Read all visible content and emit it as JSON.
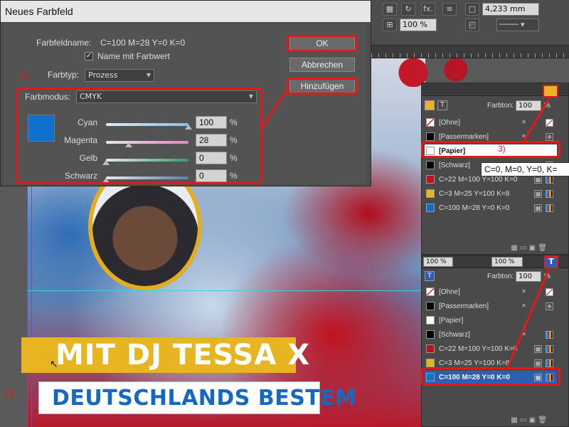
{
  "dialog": {
    "title": "Neues Farbfeld",
    "swatch_name_label": "Farbfeldname:",
    "swatch_name_value": "C=100 M=28 Y=0 K=0",
    "name_with_value_label": "Name mit Farbwert",
    "name_with_value_checked": "✓",
    "color_type_label": "Farbtyp:",
    "color_type_value": "Prozess",
    "color_mode_label": "Farbmodus:",
    "color_mode_value": "CMYK",
    "preview_color": "#1070cd",
    "channels": [
      {
        "label": "Cyan",
        "value": "100",
        "unit": "%",
        "fraction": 1.0,
        "color": "#7ac6ee"
      },
      {
        "label": "Magenta",
        "value": "28",
        "unit": "%",
        "fraction": 0.28,
        "color": "#e087c0"
      },
      {
        "label": "Gelb",
        "value": "0",
        "unit": "%",
        "fraction": 0.0,
        "color": "#2fa06a"
      },
      {
        "label": "Schwarz",
        "value": "0",
        "unit": "%",
        "fraction": 0.0,
        "color": "#5a7fa8"
      }
    ],
    "buttons": {
      "ok": "OK",
      "cancel": "Abbrechen",
      "add": "Hinzufügen"
    }
  },
  "annotations": {
    "marker_1": "1)",
    "marker_2": "2)",
    "marker_3": "3)",
    "highlight_color": "#e31818"
  },
  "toolbar": {
    "icons": [
      "frame-icon",
      "rotate-icon",
      "fx-icon",
      "stroke-icon"
    ],
    "fx_label": "fx.",
    "stroke_value": "4,233 mm",
    "zoom_value": "100 %"
  },
  "document": {
    "headline": "MIT DJ TESSA X",
    "subline": "DEUTSCHLANDS BESTEM",
    "banner_color": "#e7b422",
    "subline_color": "#1569c3"
  },
  "swatches_top": {
    "tint_label": "Farbton:",
    "tint_value": "100",
    "tint_unit": "%",
    "active_fill_color": "#e7b422",
    "rows": [
      {
        "label": "[Ohne]",
        "chip": "none"
      },
      {
        "label": "[Passermarken]",
        "chip": "#000000"
      },
      {
        "label": "[Papier]",
        "chip": "#ffffff"
      },
      {
        "label": "[Schwarz]",
        "chip": "#000000"
      },
      {
        "label": "C=22 M=100 Y=100 K=0",
        "chip": "#b8141f"
      },
      {
        "label": "C=3 M=25 Y=100 K=8",
        "chip": "#e7b422"
      },
      {
        "label": "C=100 M=28 Y=0 K=0",
        "chip": "#1070cd"
      }
    ],
    "tooltip": "C=0, M=0, Y=0, K="
  },
  "swatches_bottom": {
    "tint_label": "Farbton:",
    "tint_value": "100",
    "tint_unit": "%",
    "stroke_pct": "100 %",
    "fill_pct": "100 %",
    "rows": [
      {
        "label": "[Ohne]",
        "chip": "none"
      },
      {
        "label": "[Passermarken]",
        "chip": "#000000"
      },
      {
        "label": "[Papier]",
        "chip": "#ffffff"
      },
      {
        "label": "[Schwarz]",
        "chip": "#000000"
      },
      {
        "label": "C=22 M=100 Y=100 K=0",
        "chip": "#b8141f"
      },
      {
        "label": "C=3 M=25 Y=100 K=8",
        "chip": "#e7b422"
      },
      {
        "label": "C=100 M=28 Y=0 K=0",
        "chip": "#1070cd"
      }
    ]
  }
}
